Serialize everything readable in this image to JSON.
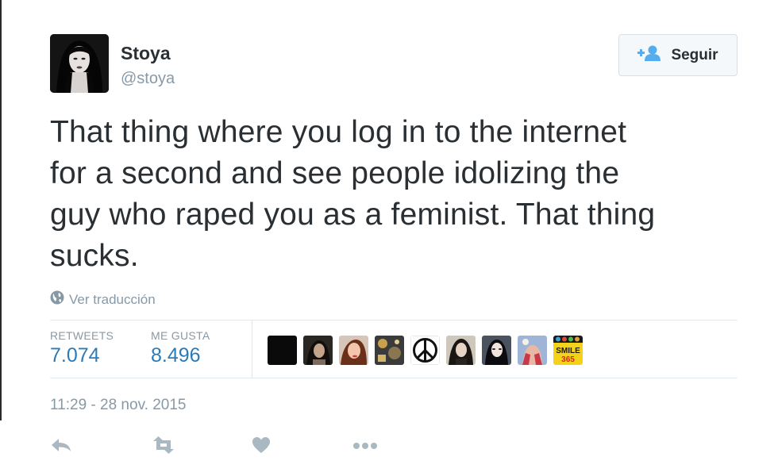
{
  "user": {
    "name": "Stoya",
    "handle": "@stoya"
  },
  "follow_button": {
    "label": "Seguir",
    "icon": "add-user-icon"
  },
  "tweet": {
    "text_lines": [
      "That thing where you log in to the internet",
      "for a second and see people idolizing the",
      "guy who raped you as a feminist. That thing",
      "sucks."
    ],
    "translate_label": "Ver traducción",
    "translate_icon": "globe-icon"
  },
  "stats": {
    "retweets_label": "RETWEETS",
    "retweets_value": "7.074",
    "likes_label": "ME GUSTA",
    "likes_value": "8.496"
  },
  "likers": [
    {
      "icon": "liker-avatar"
    },
    {
      "icon": "liker-avatar"
    },
    {
      "icon": "liker-avatar"
    },
    {
      "icon": "liker-avatar"
    },
    {
      "icon": "peace-sign-avatar"
    },
    {
      "icon": "liker-avatar"
    },
    {
      "icon": "liker-avatar"
    },
    {
      "icon": "liker-avatar"
    },
    {
      "icon": "smile-365-avatar",
      "text_top": "SMILE",
      "text_bottom": "365"
    }
  ],
  "timestamp": "11:29 - 28 nov. 2015",
  "actions": [
    "reply-icon",
    "retweet-icon",
    "like-icon",
    "more-icon"
  ],
  "colors": {
    "text": "#292f33",
    "muted": "#8899a6",
    "link_blue": "#2b7bb9",
    "icon_gray": "#aab8c2",
    "follow_icon_blue": "#55acee",
    "border": "#e1e8ed"
  }
}
